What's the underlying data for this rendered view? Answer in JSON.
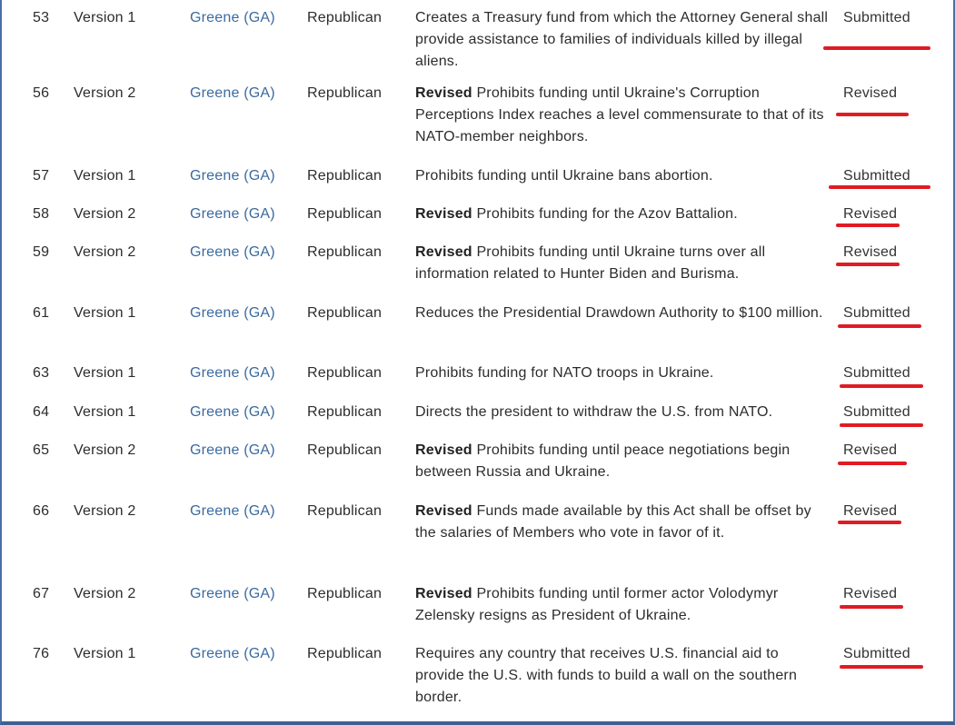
{
  "table": {
    "rows": [
      {
        "num": "53",
        "version": "Version 1",
        "sponsor": "Greene (GA)",
        "party": "Republican",
        "revised": "",
        "description": "Creates a Treasury fund from which the Attorney General shall provide assistance to families of individuals killed by illegal aliens.",
        "status": "Submitted"
      },
      {
        "num": "56",
        "version": "Version 2",
        "sponsor": "Greene (GA)",
        "party": "Republican",
        "revised": "Revised",
        "description": "Prohibits funding until Ukraine's Corruption Perceptions Index reaches a level commensurate to that of its NATO-member neighbors.",
        "status": "Revised"
      },
      {
        "num": "57",
        "version": "Version 1",
        "sponsor": "Greene (GA)",
        "party": "Republican",
        "revised": "",
        "description": "Prohibits funding until Ukraine bans abortion.",
        "status": "Submitted"
      },
      {
        "num": "58",
        "version": "Version 2",
        "sponsor": "Greene (GA)",
        "party": "Republican",
        "revised": "Revised",
        "description": "Prohibits funding for the Azov Battalion.",
        "status": "Revised"
      },
      {
        "num": "59",
        "version": "Version 2",
        "sponsor": "Greene (GA)",
        "party": "Republican",
        "revised": "Revised",
        "description": "Prohibits funding until Ukraine turns over all information related to Hunter Biden and Burisma.",
        "status": "Revised"
      },
      {
        "num": "61",
        "version": "Version 1",
        "sponsor": "Greene (GA)",
        "party": "Republican",
        "revised": "",
        "description": "Reduces the Presidential Drawdown Authority to $100 million.",
        "status": "Submitted"
      },
      {
        "num": "63",
        "version": "Version 1",
        "sponsor": "Greene (GA)",
        "party": "Republican",
        "revised": "",
        "description": "Prohibits funding for NATO troops in Ukraine.",
        "status": "Submitted"
      },
      {
        "num": "64",
        "version": "Version 1",
        "sponsor": "Greene (GA)",
        "party": "Republican",
        "revised": "",
        "description": "Directs the president to withdraw the U.S. from NATO.",
        "status": "Submitted"
      },
      {
        "num": "65",
        "version": "Version 2",
        "sponsor": "Greene (GA)",
        "party": "Republican",
        "revised": "Revised",
        "description": "Prohibits funding until peace negotiations begin between Russia and Ukraine.",
        "status": "Revised"
      },
      {
        "num": "66",
        "version": "Version 2",
        "sponsor": "Greene (GA)",
        "party": "Republican",
        "revised": "Revised",
        "description": "Funds made available by this Act shall be offset by the salaries of Members who vote in favor of it.",
        "status": "Revised"
      },
      {
        "num": "67",
        "version": "Version 2",
        "sponsor": "Greene (GA)",
        "party": "Republican",
        "revised": "Revised",
        "description": "Prohibits funding until former actor Volodymyr Zelensky resigns as President of Ukraine.",
        "status": "Revised"
      },
      {
        "num": "76",
        "version": "Version 1",
        "sponsor": "Greene (GA)",
        "party": "Republican",
        "revised": "",
        "description": "Requires any country that receives U.S. financial aid to provide the U.S. with funds to build a wall on the southern border.",
        "status": "Submitted"
      }
    ]
  },
  "colors": {
    "link": "#3a6aa0",
    "text": "#2c2c2c",
    "annotation": "#e01b23",
    "frame": "#4a6fa5"
  }
}
